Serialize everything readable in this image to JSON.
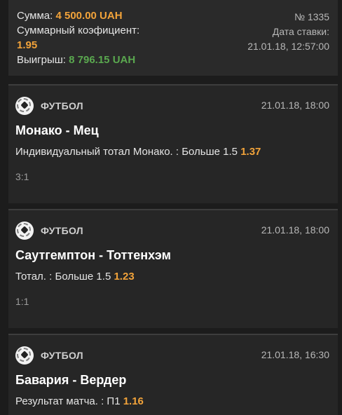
{
  "summary": {
    "amount_label": "Сумма:",
    "amount_value": "4 500.00 UAH",
    "coef_label": "Суммарный коэфициент:",
    "coef_value": "1.95",
    "win_label": "Выигрыш:",
    "win_value": "8 796.15 UAH",
    "number": "№ 1335",
    "date_label": "Дата ставки:",
    "date_value": "21.01.18, 12:57:00"
  },
  "bets": [
    {
      "sport": "ФУТБОЛ",
      "date": "21.01.18, 18:00",
      "match": "Монако - Мец",
      "market": "Индивидуальный тотал Монако. : Больше 1.5",
      "odds": "1.37",
      "score": "3:1"
    },
    {
      "sport": "ФУТБОЛ",
      "date": "21.01.18, 18:00",
      "match": "Саутгемптон - Тоттенхэм",
      "market": "Тотал. : Больше 1.5",
      "odds": "1.23",
      "score": "1:1"
    },
    {
      "sport": "ФУТБОЛ",
      "date": "21.01.18, 16:30",
      "match": "Бавария - Вердер",
      "market": "Результат матча. : П1",
      "odds": "1.16",
      "score": ""
    }
  ],
  "icons": {
    "sport_icon": "soccer-ball-icon"
  },
  "colors": {
    "odds": "#f2a33a",
    "win": "#5aa84f",
    "background": "#1c1c1c",
    "card": "#262626"
  }
}
